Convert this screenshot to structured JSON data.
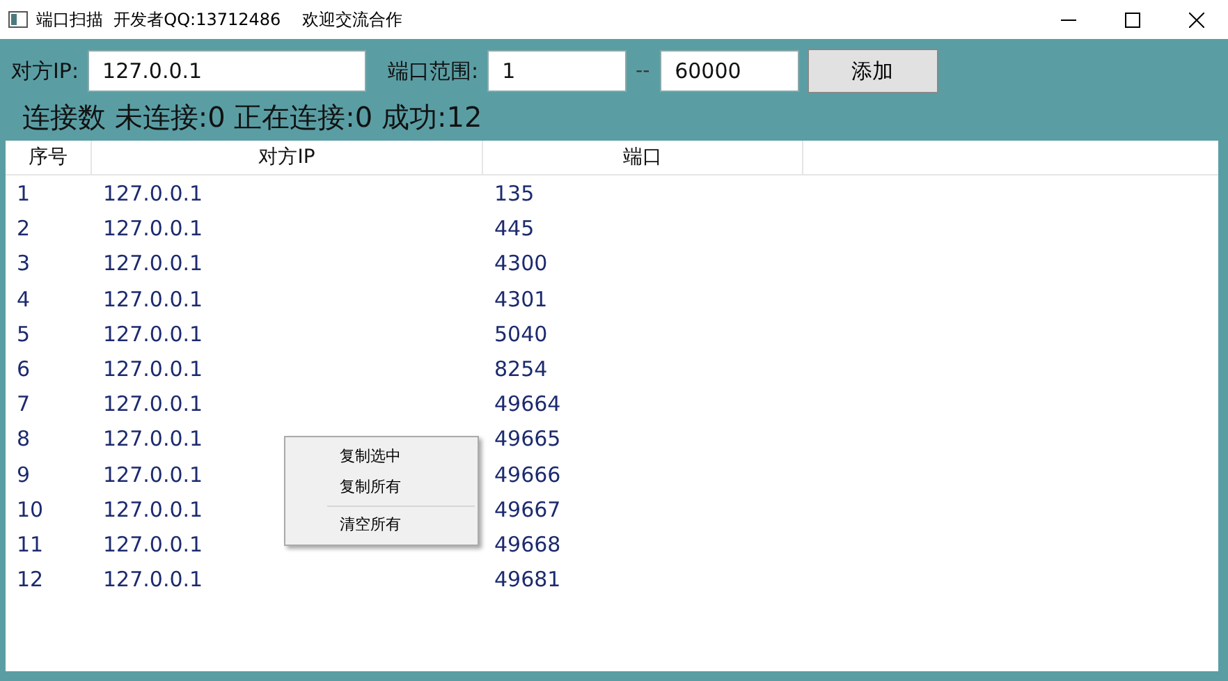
{
  "window": {
    "title": "端口扫描  开发者QQ:13712486    欢迎交流合作"
  },
  "toolbar": {
    "ip_label": "对方IP:",
    "ip_value": "127.0.0.1",
    "range_label": "端口范围:",
    "port_from": "1",
    "separator": "--",
    "port_to": "60000",
    "add_button": "添加"
  },
  "status": "连接数 未连接:0 正在连接:0 成功:12",
  "table": {
    "columns": [
      "序号",
      "对方IP",
      "端口"
    ],
    "rows": [
      [
        "1",
        "127.0.0.1",
        "135"
      ],
      [
        "2",
        "127.0.0.1",
        "445"
      ],
      [
        "3",
        "127.0.0.1",
        "4300"
      ],
      [
        "4",
        "127.0.0.1",
        "4301"
      ],
      [
        "5",
        "127.0.0.1",
        "5040"
      ],
      [
        "6",
        "127.0.0.1",
        "8254"
      ],
      [
        "7",
        "127.0.0.1",
        "49664"
      ],
      [
        "8",
        "127.0.0.1",
        "49665"
      ],
      [
        "9",
        "127.0.0.1",
        "49666"
      ],
      [
        "10",
        "127.0.0.1",
        "49667"
      ],
      [
        "11",
        "127.0.0.1",
        "49668"
      ],
      [
        "12",
        "127.0.0.1",
        "49681"
      ]
    ]
  },
  "context_menu": {
    "items": [
      {
        "label": "复制选中",
        "kind": "item"
      },
      {
        "label": "复制所有",
        "kind": "item"
      },
      {
        "kind": "separator"
      },
      {
        "label": "清空所有",
        "kind": "item"
      }
    ]
  }
}
